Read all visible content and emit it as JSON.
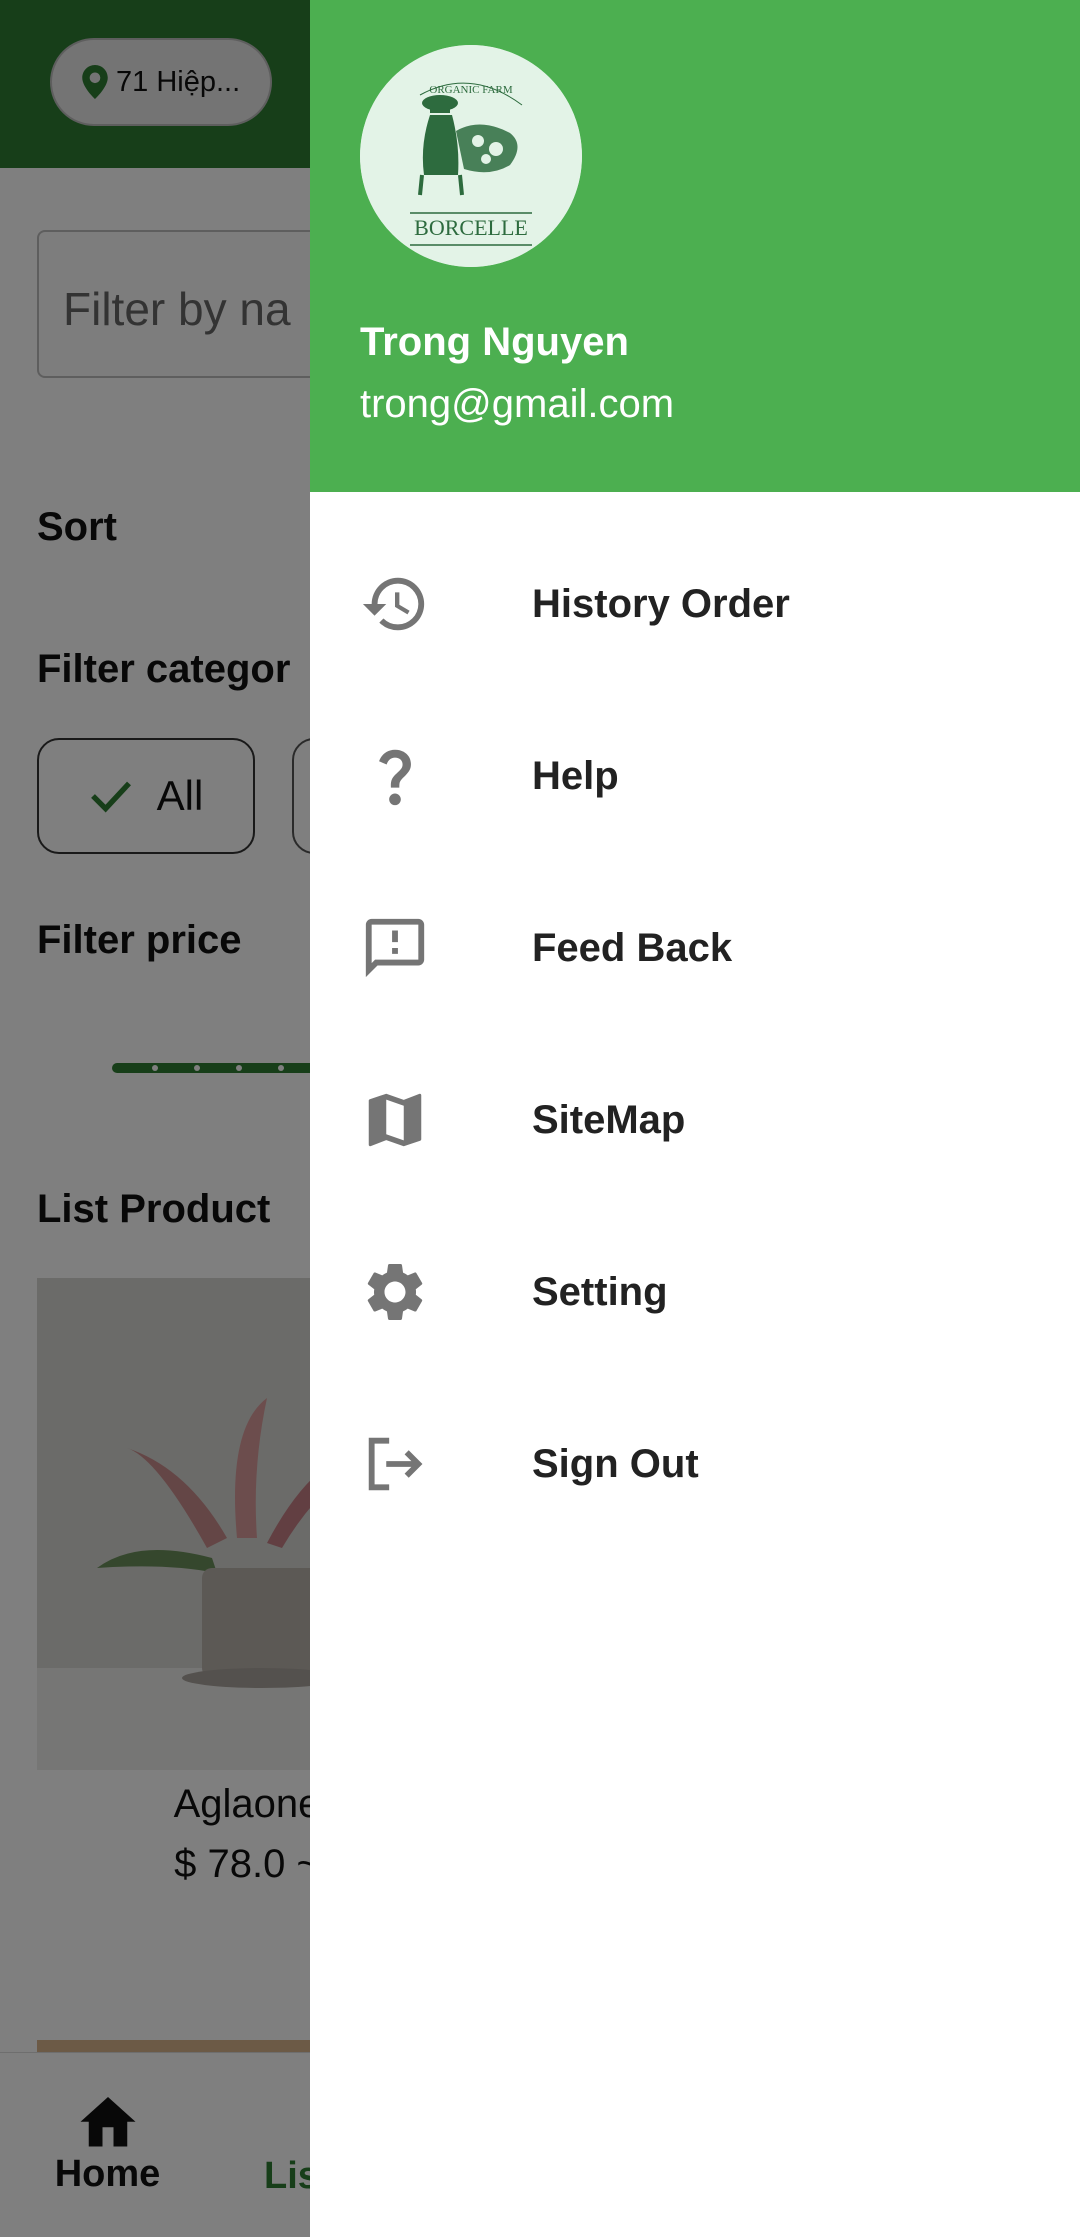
{
  "app": {
    "location_chip": "71 Hiệp...",
    "filter_placeholder": "Filter by na",
    "sort_label": "Sort",
    "filter_category_label": "Filter categor",
    "category_chip_all": "All",
    "filter_price_label": "Filter price",
    "list_product_label": "List Product",
    "product": {
      "name": "Aglaone",
      "price": "$ 78.0 ~"
    },
    "bottom_nav": {
      "home": "Home",
      "list": "Lis"
    }
  },
  "drawer": {
    "user": {
      "name": "Trong Nguyen",
      "email": "trong@gmail.com"
    },
    "avatar": {
      "logo_text": "BORCELLE",
      "arc_text": "ORGANIC FARM"
    },
    "colors": {
      "header": "#4caf50",
      "icon": "#757575",
      "text": "#222222"
    },
    "menu": [
      {
        "label": "History Order",
        "icon": "history-icon"
      },
      {
        "label": "Help",
        "icon": "question-mark-icon"
      },
      {
        "label": "Feed Back",
        "icon": "feedback-icon"
      },
      {
        "label": "SiteMap",
        "icon": "map-icon"
      },
      {
        "label": "Setting",
        "icon": "gear-icon"
      },
      {
        "label": "Sign Out",
        "icon": "sign-out-icon"
      }
    ]
  }
}
